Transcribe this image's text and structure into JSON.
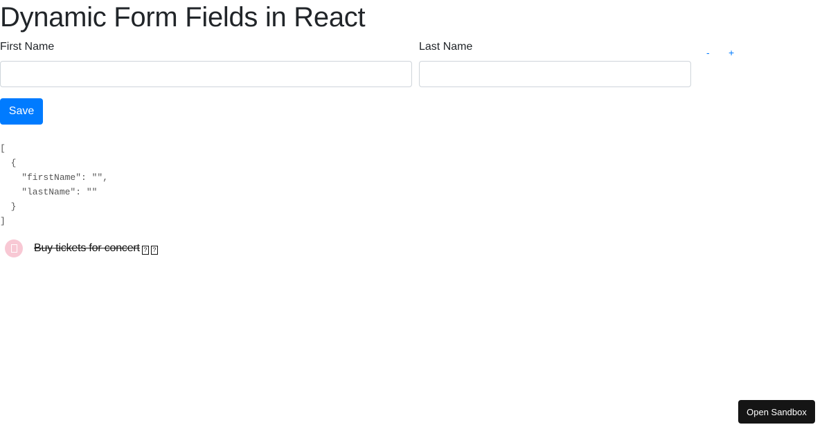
{
  "page": {
    "title": "Dynamic Form Fields in React"
  },
  "form": {
    "rows": [
      {
        "first_name": {
          "label": "First Name",
          "value": "",
          "placeholder": ""
        },
        "last_name": {
          "label": "Last Name",
          "value": "",
          "placeholder": ""
        },
        "remove_label": "-",
        "add_label": "+"
      }
    ],
    "save_label": "Save"
  },
  "debug_output": "[\n  {\n    \"firstName\": \"\",\n    \"lastName\": \"\"\n  }\n]",
  "todo": {
    "icon": "missing-glyph-icon",
    "text": "Buy tickets for concert",
    "completed": true,
    "trailing_glyphs": [
      "?",
      "?"
    ]
  },
  "sandbox_button": {
    "label": "Open Sandbox"
  },
  "colors": {
    "primary": "#007bff",
    "sandbox_bg": "#151515",
    "todo_icon_bg": "#f8c8d4"
  }
}
